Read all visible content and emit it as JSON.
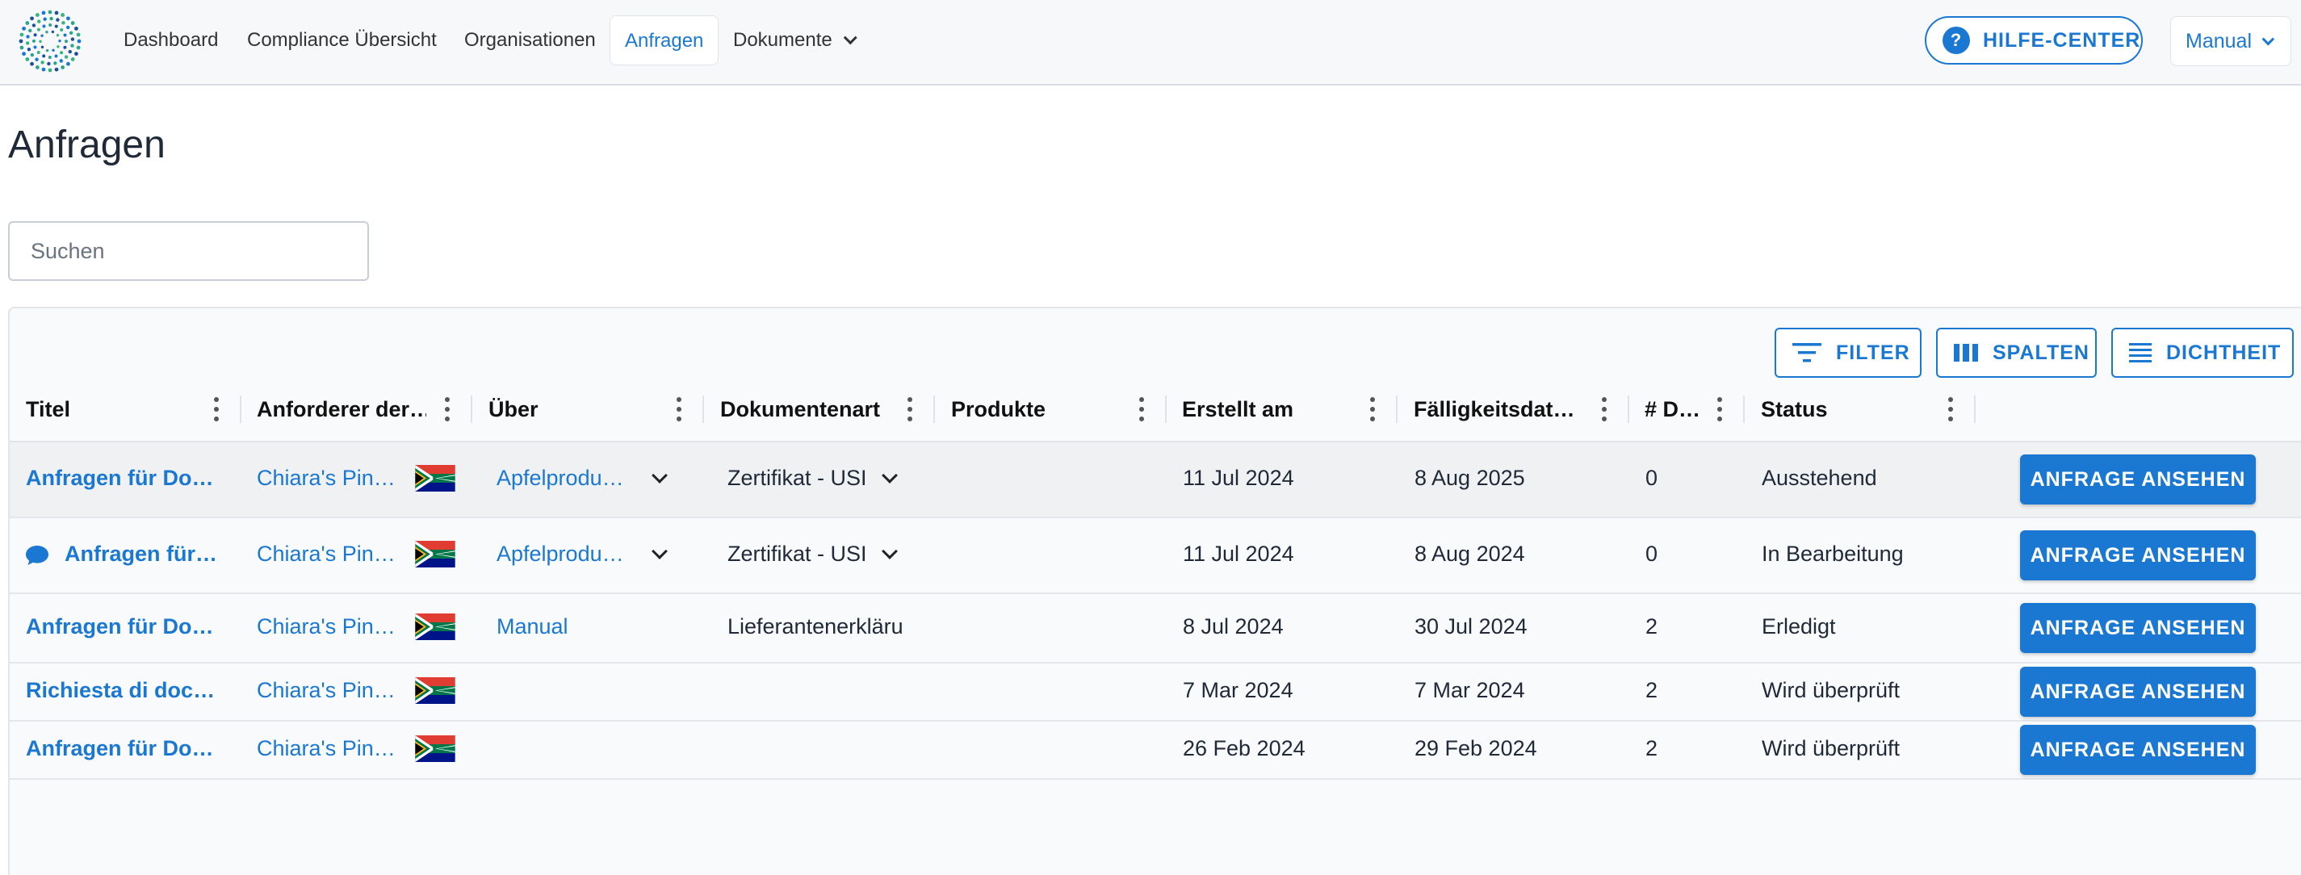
{
  "nav": {
    "items": [
      {
        "label": "Dashboard"
      },
      {
        "label": "Compliance Übersicht"
      },
      {
        "label": "Organisationen"
      },
      {
        "label": "Anfragen"
      },
      {
        "label": "Dokumente"
      }
    ],
    "help_label": "HILFE-CENTER",
    "user_label": "Manual"
  },
  "page": {
    "title": "Anfragen"
  },
  "search": {
    "placeholder": "Suchen",
    "value": ""
  },
  "toolbar": {
    "filter": "FILTER",
    "columns": "SPALTEN",
    "density": "DICHTHEIT"
  },
  "columns": [
    "Titel",
    "Anforderer der…",
    "Über",
    "Dokumentenart",
    "Produkte",
    "Erstellt am",
    "Fälligkeitsdat…",
    "# D…",
    "Status"
  ],
  "rows": [
    {
      "title": "Anfragen für Dok…",
      "requester": "Chiara's Pin…",
      "about": "Apfelprodu…",
      "doctype": "Zertifikat - USI",
      "created": "11 Jul 2024",
      "due": "8 Aug 2025",
      "count": "0",
      "status": "Ausstehend",
      "action": "ANFRAGE ANSEHEN"
    },
    {
      "title": "Anfragen für …",
      "requester": "Chiara's Pin…",
      "about": "Apfelprodu…",
      "doctype": "Zertifikat - USI",
      "created": "11 Jul 2024",
      "due": "8 Aug 2024",
      "count": "0",
      "status": "In Bearbeitung",
      "action": "ANFRAGE ANSEHEN"
    },
    {
      "title": "Anfragen für Dok…",
      "requester": "Chiara's Pin…",
      "about": "Manual",
      "doctype": "Lieferantenerkläru",
      "created": "8 Jul 2024",
      "due": "30 Jul 2024",
      "count": "2",
      "status": "Erledigt",
      "action": "ANFRAGE ANSEHEN"
    },
    {
      "title": "Richiesta di docu…",
      "requester": "Chiara's Pin…",
      "about": "",
      "doctype": "",
      "created": "7 Mar 2024",
      "due": "7 Mar 2024",
      "count": "2",
      "status": "Wird überprüft",
      "action": "ANFRAGE ANSEHEN"
    },
    {
      "title": "Anfragen für Dok…",
      "requester": "Chiara's Pin…",
      "about": "",
      "doctype": "",
      "created": "26 Feb 2024",
      "due": "29 Feb 2024",
      "count": "2",
      "status": "Wird überprüft",
      "action": "ANFRAGE ANSEHEN"
    }
  ],
  "colors": {
    "accent": "#1a78d2",
    "row_selected": "#f0f1f3"
  }
}
